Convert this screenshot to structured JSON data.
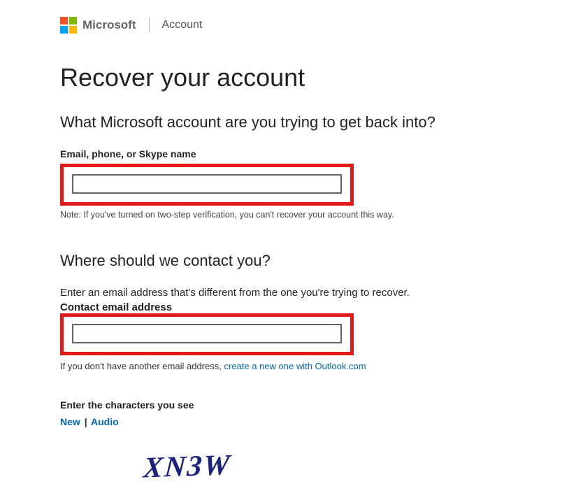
{
  "header": {
    "brand": "Microsoft",
    "product": "Account"
  },
  "title": "Recover your account",
  "section1": {
    "question": "What Microsoft account are you trying to get back into?",
    "label": "Email, phone, or Skype name",
    "value": "",
    "note": "Note: If you've turned on two-step verification, you can't recover your account this way."
  },
  "section2": {
    "question": "Where should we contact you?",
    "instruction": "Enter an email address that's different from the one you're trying to recover.",
    "label": "Contact email address",
    "value": "",
    "helper_prefix": "If you don't have another email address, ",
    "helper_link": "create a new one with Outlook.com"
  },
  "captcha": {
    "label": "Enter the characters you see",
    "new": "New",
    "audio": "Audio",
    "text": "XN3W"
  }
}
